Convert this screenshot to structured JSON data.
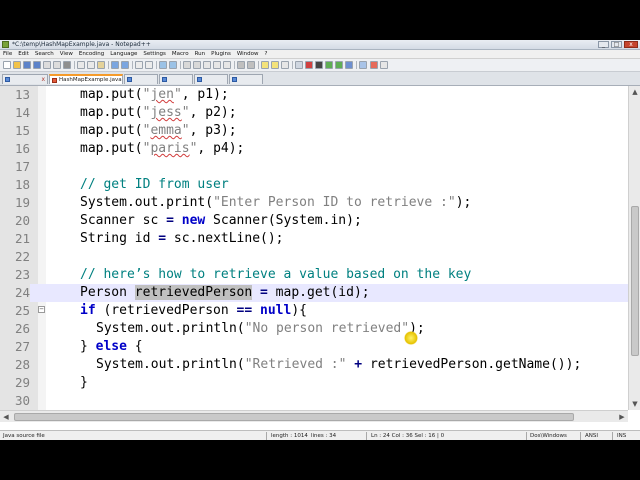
{
  "window": {
    "title": "*C:\\temp\\HashMapExample.java - Notepad++",
    "minimize": "_",
    "maximize": "□",
    "close": "x"
  },
  "menu": [
    "File",
    "Edit",
    "Search",
    "View",
    "Encoding",
    "Language",
    "Settings",
    "Macro",
    "Run",
    "Plugins",
    "Window",
    "?"
  ],
  "tabs": [
    {
      "label": "",
      "active": false
    },
    {
      "label": "HashMapExample.java",
      "active": true
    },
    {
      "label": "",
      "active": false
    },
    {
      "label": "",
      "active": false
    },
    {
      "label": "",
      "active": false
    },
    {
      "label": "",
      "active": false
    }
  ],
  "editor": {
    "current_line": 24,
    "lines": [
      {
        "n": "13",
        "code": "map.put(\"jen\", p1);"
      },
      {
        "n": "14",
        "code": "map.put(\"jess\", p2);"
      },
      {
        "n": "15",
        "code": "map.put(\"emma\", p3);"
      },
      {
        "n": "16",
        "code": "map.put(\"paris\", p4);"
      },
      {
        "n": "17",
        "code": ""
      },
      {
        "n": "18",
        "code": "// get ID from user"
      },
      {
        "n": "19",
        "code": "System.out.print(\"Enter Person ID to retrieve :\");"
      },
      {
        "n": "20",
        "code": "Scanner sc = new Scanner(System.in);"
      },
      {
        "n": "21",
        "code": "String id = sc.nextLine();"
      },
      {
        "n": "22",
        "code": ""
      },
      {
        "n": "23",
        "code": "// here’s how to retrieve a value based on the key"
      },
      {
        "n": "24",
        "code": "Person retrievedPerson = map.get(id);"
      },
      {
        "n": "25",
        "code": "if (retrievedPerson == null){"
      },
      {
        "n": "26",
        "code": "System.out.println(\"No person retrieved\");"
      },
      {
        "n": "27",
        "code": "} else {"
      },
      {
        "n": "28",
        "code": "System.out.println(\"Retrieved :\" + retrievedPerson.getName());"
      },
      {
        "n": "29",
        "code": "}"
      },
      {
        "n": "30",
        "code": ""
      },
      {
        "n": "31",
        "code": ""
      }
    ]
  },
  "status": {
    "file_type": "Java source file",
    "length": "length : 1014",
    "lines": "lines : 34",
    "position": "Ln : 24   Col : 36   Sel : 16 | 0",
    "eol": "Dos\\Windows",
    "encoding": "ANSI",
    "mode": "INS"
  },
  "colors": {
    "keyword": "#0000c8",
    "string": "#808080",
    "comment": "#008080",
    "current_line": "#e8e8ff",
    "selection": "#c0c0c0",
    "active_tab_accent": "#f59b2b"
  }
}
